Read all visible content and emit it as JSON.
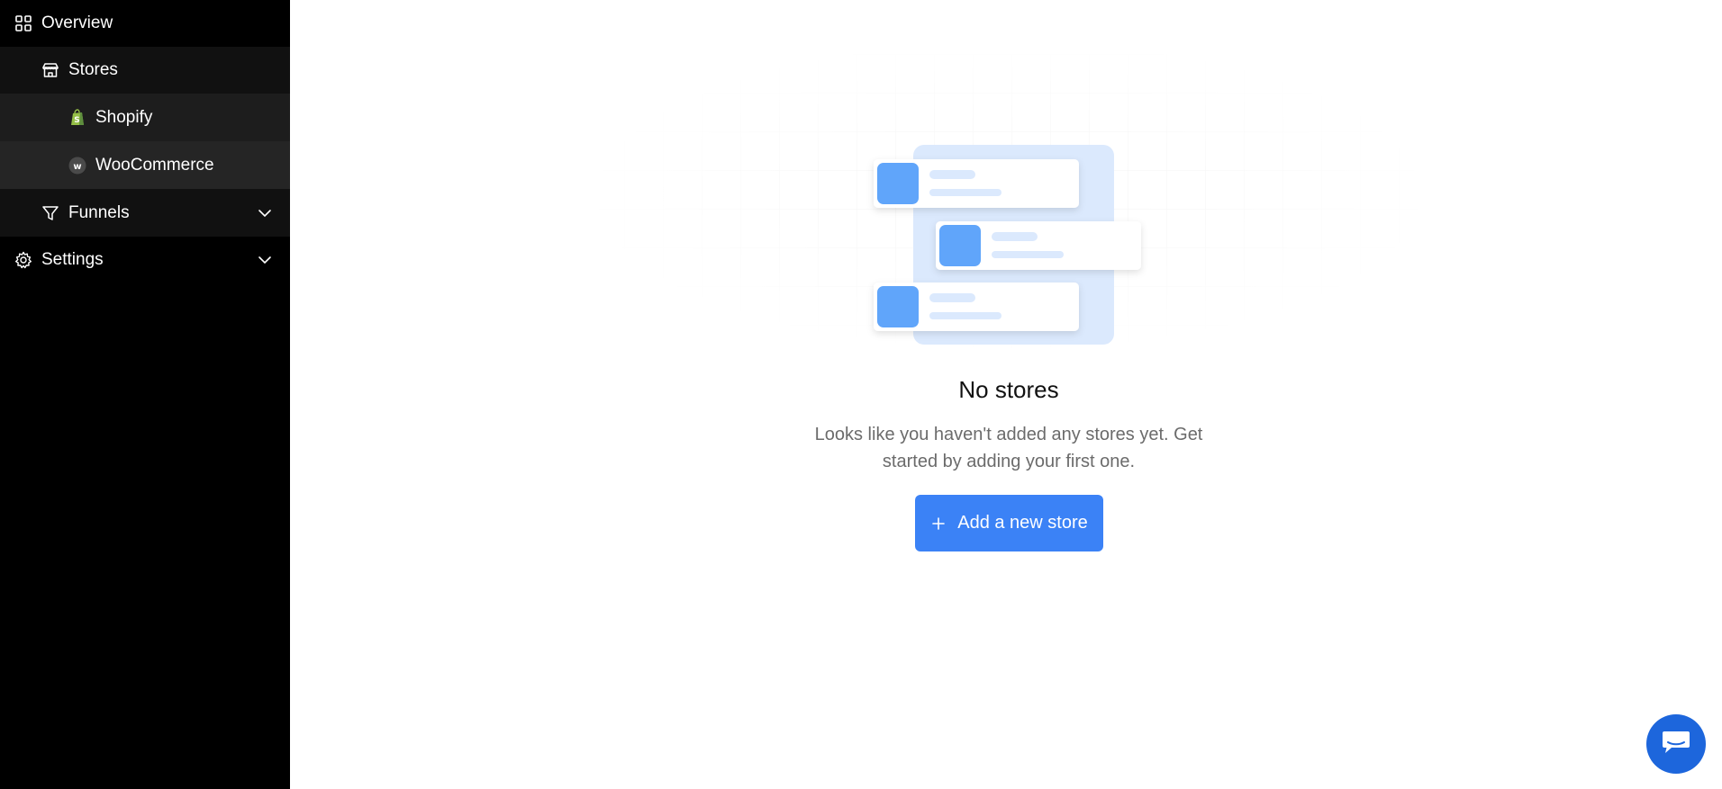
{
  "sidebar": {
    "items": [
      {
        "label": "Overview",
        "icon": "grid-icon"
      },
      {
        "label": "Stores",
        "icon": "store-icon"
      },
      {
        "label": "Shopify",
        "icon": "shopify-icon"
      },
      {
        "label": "WooCommerce",
        "icon": "woocommerce-icon"
      },
      {
        "label": "Funnels",
        "icon": "funnel-icon"
      },
      {
        "label": "Settings",
        "icon": "gear-icon"
      }
    ]
  },
  "empty_state": {
    "title": "No stores",
    "description": "Looks like you haven't added any stores yet. Get started by adding your first one.",
    "button_label": "Add a new store"
  },
  "colors": {
    "sidebar_bg": "#000000",
    "accent": "#3b82f6",
    "chat_button": "#1d66dc"
  }
}
